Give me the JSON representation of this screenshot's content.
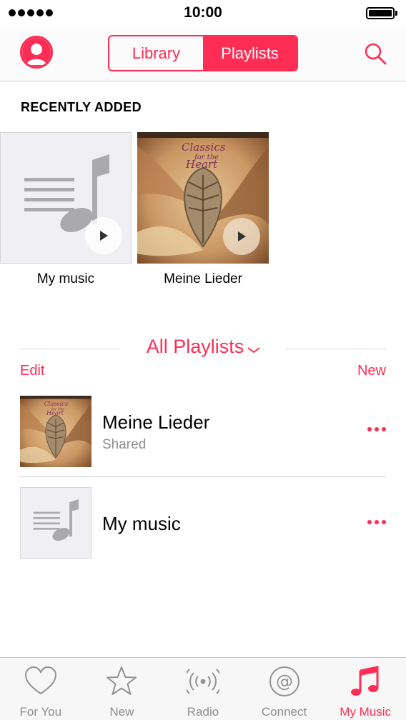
{
  "status_bar": {
    "time": "10:00",
    "signal_dots": 5,
    "battery_level": 1.0
  },
  "header": {
    "segments": [
      {
        "label": "Library",
        "active": false
      },
      {
        "label": "Playlists",
        "active": true
      }
    ],
    "icons": {
      "left": "profile-icon",
      "right": "search-icon"
    }
  },
  "recently_added": {
    "title": "RECENTLY ADDED",
    "items": [
      {
        "label": "My music",
        "art": "music-placeholder-icon"
      },
      {
        "label": "Meine Lieder",
        "art": "album-art-classics"
      }
    ]
  },
  "playlists": {
    "title": "All Playlists",
    "edit_label": "Edit",
    "new_label": "New",
    "items": [
      {
        "title": "Meine Lieder",
        "subtitle": "Shared",
        "art": "album-art-classics"
      },
      {
        "title": "My music",
        "subtitle": "",
        "art": "music-placeholder-icon"
      }
    ],
    "artwork_text": {
      "line1": "Classics",
      "line2": "for the",
      "line3": "Heart"
    }
  },
  "tab_bar": {
    "tabs": [
      {
        "label": "For You",
        "icon": "heart-icon",
        "active": false
      },
      {
        "label": "New",
        "icon": "star-icon",
        "active": false
      },
      {
        "label": "Radio",
        "icon": "radio-waves-icon",
        "active": false
      },
      {
        "label": "Connect",
        "icon": "at-sign-icon",
        "active": false
      },
      {
        "label": "My Music",
        "icon": "music-note-icon",
        "active": true
      }
    ]
  },
  "colors": {
    "accent": "#ff2d55",
    "secondary_text": "#8e8e93",
    "placeholder_bg": "#efeff4"
  }
}
